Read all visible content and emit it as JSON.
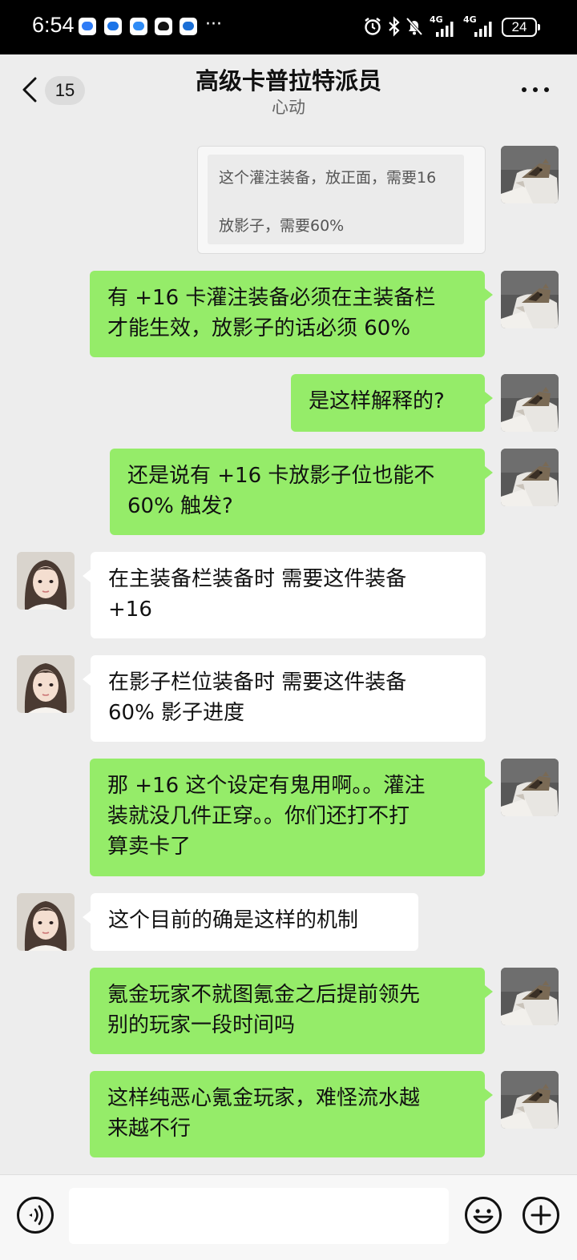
{
  "status_bar": {
    "time": "6:54",
    "more": "···",
    "network_1": "4G",
    "network_2": "4G",
    "battery": "24"
  },
  "header": {
    "unread_count": "15",
    "title": "高级卡普拉特派员",
    "subtitle": "心动"
  },
  "messages": [
    {
      "side": "right",
      "type": "image",
      "image_text": [
        "这个灌注装备，放正面，需要16",
        "放影子，需要60%"
      ]
    },
    {
      "side": "right",
      "type": "text",
      "lines": [
        "有 +16 卡灌注装备必须在主装备栏",
        "才能生效，放影子的话必须 60%"
      ]
    },
    {
      "side": "right",
      "type": "text",
      "lines": [
        "是这样解释的?"
      ]
    },
    {
      "side": "right",
      "type": "text",
      "lines": [
        "还是说有 +16 卡放影子位也能不",
        "60% 触发?"
      ]
    },
    {
      "side": "left",
      "type": "text",
      "lines": [
        "在主装备栏装备时 需要这件装备",
        "+16"
      ]
    },
    {
      "side": "left",
      "type": "text",
      "lines": [
        "在影子栏位装备时 需要这件装备",
        "60% 影子进度"
      ]
    },
    {
      "side": "right",
      "type": "text",
      "lines": [
        "那 +16 这个设定有鬼用啊。。灌注",
        "装就没几件正穿。。你们还打不打",
        "算卖卡了"
      ]
    },
    {
      "side": "left",
      "type": "text",
      "lines": [
        "这个目前的确是这样的机制"
      ]
    },
    {
      "side": "right",
      "type": "text",
      "lines": [
        "氪金玩家不就图氪金之后提前领先",
        "别的玩家一段时间吗"
      ]
    },
    {
      "side": "right",
      "type": "text",
      "lines": [
        "这样纯恶心氪金玩家，难怪流水越",
        "来越不行"
      ]
    }
  ],
  "input": {
    "value": "",
    "placeholder": ""
  },
  "icons": {
    "back": "chevron-left-icon",
    "more": "more-dots-icon",
    "voice": "voice-icon",
    "emoji": "emoji-icon",
    "plus": "plus-icon"
  },
  "colors": {
    "my_bubble": "#95ec69",
    "their_bubble": "#ffffff",
    "background": "#ededed"
  }
}
